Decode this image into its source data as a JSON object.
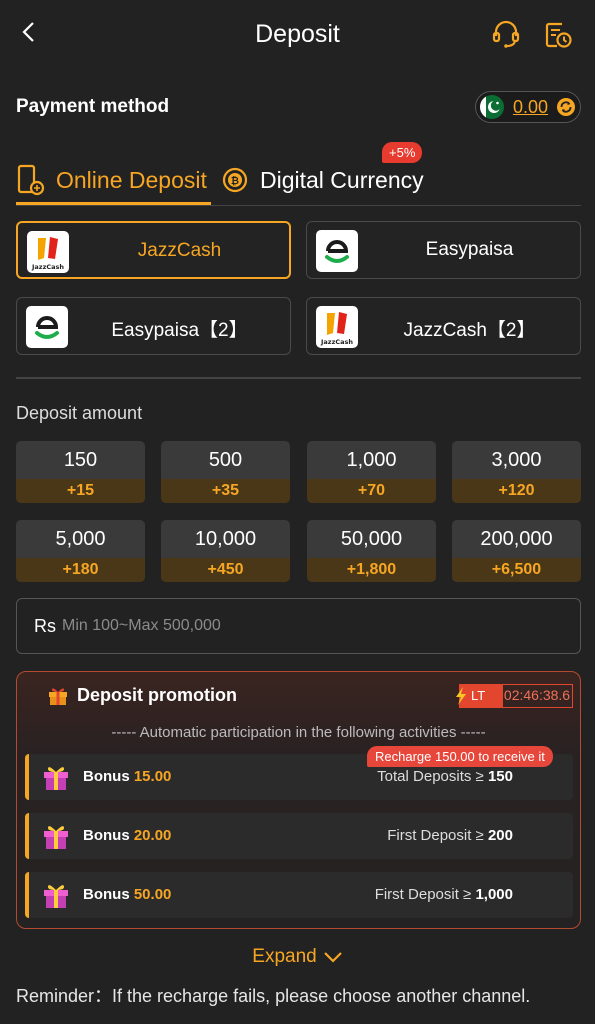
{
  "header": {
    "title": "Deposit",
    "back_icon": "chevron-left-icon",
    "support_icon": "headset-icon",
    "history_icon": "history-icon"
  },
  "payment_method": {
    "label": "Payment method",
    "balance": "0.00",
    "flag": "pakistan-flag"
  },
  "tabs": [
    {
      "label": "Online Deposit",
      "icon": "phone-icon",
      "active": true
    },
    {
      "label": "Digital Currency",
      "icon": "coin-icon",
      "active": false,
      "badge": "+5%"
    }
  ],
  "methods": [
    {
      "name": "JazzCash",
      "selected": true
    },
    {
      "name": "Easypaisa",
      "selected": false
    },
    {
      "name": "Easypaisa【2】",
      "selected": false
    },
    {
      "name": "JazzCash【2】",
      "selected": false
    }
  ],
  "deposit": {
    "label": "Deposit amount",
    "amounts": [
      {
        "value": "150",
        "bonus": "+15"
      },
      {
        "value": "500",
        "bonus": "+35"
      },
      {
        "value": "1,000",
        "bonus": "+70"
      },
      {
        "value": "3,000",
        "bonus": "+120"
      },
      {
        "value": "5,000",
        "bonus": "+180"
      },
      {
        "value": "10,000",
        "bonus": "+450"
      },
      {
        "value": "50,000",
        "bonus": "+1,800"
      },
      {
        "value": "200,000",
        "bonus": "+6,500"
      }
    ],
    "currency": "Rs",
    "placeholder": "Min 100~Max 500,000"
  },
  "promotion": {
    "title": "Deposit promotion",
    "lt_label": "LT",
    "timer": "02:46:38.6",
    "subtitle": "----- Automatic participation in the following activities -----",
    "recharge_tip": "Recharge 150.00 to receive it",
    "activities": [
      {
        "bonus_label": "Bonus",
        "bonus_value": "15.00",
        "condition": "Total Deposits ≥",
        "condition_value": "150"
      },
      {
        "bonus_label": "Bonus",
        "bonus_value": "20.00",
        "condition": "First Deposit ≥",
        "condition_value": "200"
      },
      {
        "bonus_label": "Bonus",
        "bonus_value": "50.00",
        "condition": "First Deposit ≥",
        "condition_value": "1,000"
      }
    ]
  },
  "expand_label": "Expand",
  "reminder": "Reminder：If the recharge fails, please choose another channel.",
  "colors": {
    "accent": "#f6a623",
    "background": "#222222",
    "alert": "#e63b2e"
  }
}
